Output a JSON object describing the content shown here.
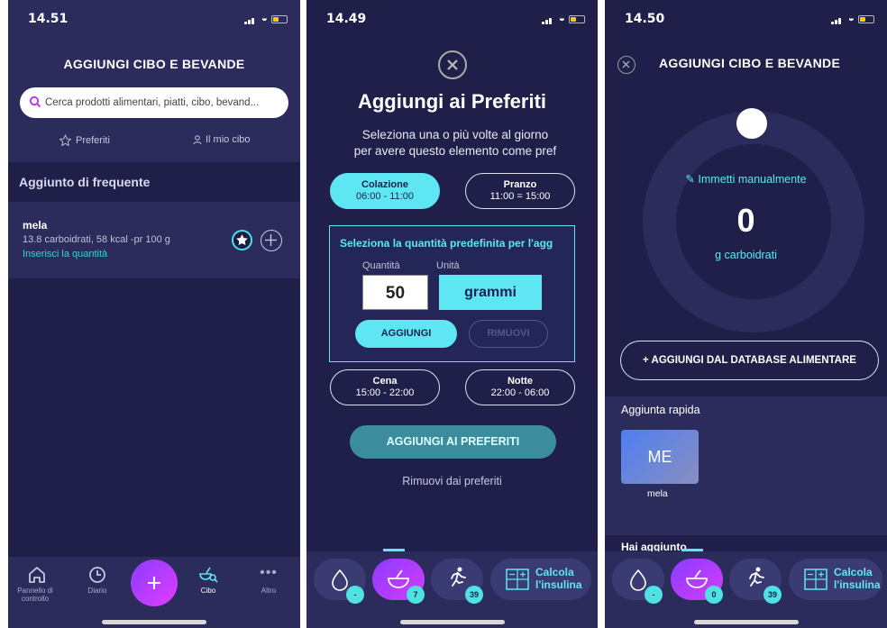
{
  "screen1": {
    "time": "14.51",
    "title": "AGGIUNGI CIBO E BEVANDE",
    "search_placeholder": "Cerca prodotti alimentari, piatti, cibo, bevand...",
    "tabs": [
      {
        "label": "Preferiti",
        "icon": "star-icon"
      },
      {
        "label": "Il mio cibo",
        "icon": "person-icon"
      }
    ],
    "section_title": "Aggiunto di frequente",
    "item": {
      "name": "mela",
      "details": "13.8 carboidrati, 58 kcal -pr 100 g",
      "action": "Inserisci la quantità"
    },
    "nav": [
      {
        "label": "Pannello di controllo",
        "icon": "home-icon"
      },
      {
        "label": "Diario",
        "icon": "clock-icon"
      },
      {
        "label": "",
        "icon": "plus-icon"
      },
      {
        "label": "Cibo",
        "icon": "food-search-icon"
      },
      {
        "label": "Altro",
        "icon": "more-icon"
      }
    ]
  },
  "screen2": {
    "time": "14.49",
    "title": "Aggiungi ai Preferiti",
    "desc_line1": "Seleziona una o più volte al giorno",
    "desc_line2": "per avere questo elemento come pref",
    "meals": [
      {
        "name": "Colazione",
        "time": "06:00 - 11:00",
        "selected": true
      },
      {
        "name": "Pranzo",
        "time": "11:00 = 15:00",
        "selected": false
      },
      {
        "name": "Cena",
        "time": "15:00 - 22:00",
        "selected": false
      },
      {
        "name": "Notte",
        "time": "22:00 - 06:00",
        "selected": false
      }
    ],
    "qty_title": "Seleziona la quantità predefinita per l'agg",
    "qty_label": "Quantità",
    "unit_label": "Unità",
    "qty_value": "50",
    "unit_value": "grammi",
    "add_label": "AGGIUNGI",
    "remove_label": "RIMUOVI",
    "add_fav_label": "AGGIUNGI AI PREFERITI",
    "remove_fav_label": "Rimuovi dai preferiti",
    "dock": {
      "water_badge": "-",
      "food_badge": "7",
      "activity_badge": "39",
      "calc_line1": "Calcola",
      "calc_line2": "l'insulina"
    }
  },
  "screen3": {
    "time": "14.50",
    "title": "AGGIUNGI CIBO E BEVANDE",
    "manual_label": "Immetti manualmente",
    "value": "0",
    "unit": "g carboidrati",
    "db_button": "+ AGGIUNGI DAL DATABASE ALIMENTARE",
    "quick_title": "Aggiunta rapida",
    "tile_text": "ME",
    "tile_label": "mela",
    "added_partial": "Hai aggiunto",
    "dock": {
      "water_badge": "-",
      "food_badge": "0",
      "activity_badge": "39",
      "calc_line1": "Calcola",
      "calc_line2": "l'insulina"
    }
  },
  "colors": {
    "background": "#1f1f4a",
    "panel": "#2b2c5c",
    "accent": "#5ee7f2",
    "fab": "#b23cff"
  }
}
